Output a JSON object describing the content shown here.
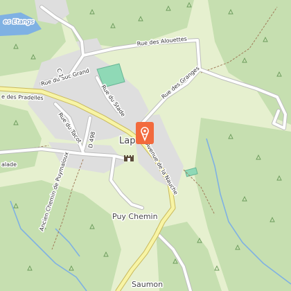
{
  "map": {
    "labels": {
      "etangs": "es Etangs",
      "rue_des_alouettes": "Rue des Alouettes",
      "rue_du_suc_grand": "Rue du Suc Grand",
      "c1": "C 1",
      "rue_du_stade": "Rue du Stade",
      "rue_des_granges": "Rue des Granges",
      "rue_des_pradelles": "e des Pradelles",
      "rue_du_tacot": "Rue du Tacot",
      "d498": "D 498",
      "town": "Lap",
      "avenue_de_la_nauche": "Avenue de la Nauche",
      "balade": "alade",
      "ancien_chemin": "Ancien Chemin de Puymaloux",
      "puy_chemin": "Puy Chemin",
      "saumon": "Saumon"
    },
    "marker": {
      "icon": "location-pin-icon",
      "color": "#f26a3d"
    },
    "poi": {
      "icon": "castle-icon"
    },
    "colors": {
      "meadow": "#e6f0cf",
      "forest": "#c6dfb0",
      "urban": "#dedede",
      "water": "#7fb1e3",
      "pitch": "#8fd9b6",
      "main_road": "#f7f4a5"
    }
  }
}
